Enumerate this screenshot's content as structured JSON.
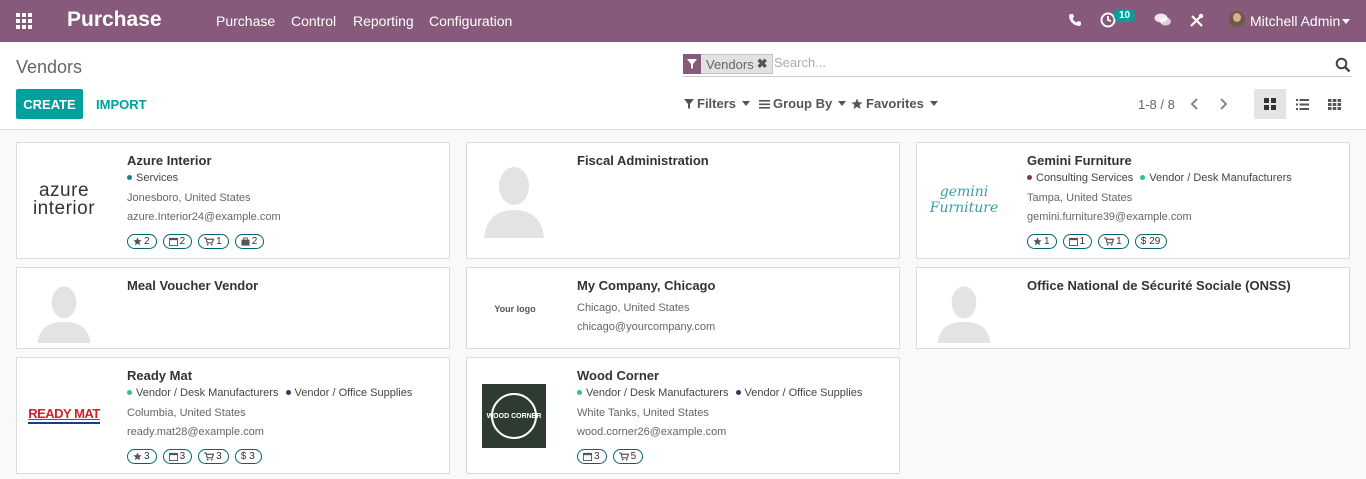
{
  "navbar": {
    "brand": "Purchase",
    "menu": [
      "Purchase",
      "Control",
      "Reporting",
      "Configuration"
    ],
    "activity_count": "10",
    "user_name": "Mitchell Admin"
  },
  "control_panel": {
    "breadcrumb": "Vendors",
    "facet": "Vendors",
    "search_placeholder": "Search...",
    "create_label": "CREATE",
    "import_label": "IMPORT",
    "filters_label": "Filters",
    "group_by_label": "Group By",
    "favorites_label": "Favorites",
    "pager": "1-8 / 8"
  },
  "colors": {
    "brand": "#875a7b",
    "accent": "#00a09d",
    "tag_services": "#1e7f87",
    "tag_consulting": "#7c3957",
    "tag_vendor_desk": "#30c381",
    "tag_vendor_office": "#2f3e5a"
  },
  "vendors": [
    {
      "name": "Azure Interior",
      "logo": "azure interior",
      "tags": [
        {
          "label": "Services",
          "color": "#1e7f87"
        }
      ],
      "location": "Jonesboro, United States",
      "email": "azure.Interior24@example.com",
      "stats": [
        {
          "icon": "star-icon",
          "value": "2"
        },
        {
          "icon": "calendar-icon",
          "value": "2"
        },
        {
          "icon": "cart-icon",
          "value": "1"
        },
        {
          "icon": "briefcase-icon",
          "value": "2"
        }
      ]
    },
    {
      "name": "Fiscal Administration",
      "logo": "",
      "tags": [],
      "location": "",
      "email": "",
      "stats": []
    },
    {
      "name": "Gemini Furniture",
      "logo": "gemini Furniture",
      "tags": [
        {
          "label": "Consulting Services",
          "color": "#7c3957"
        },
        {
          "label": "Vendor / Desk Manufacturers",
          "color": "#30c381"
        }
      ],
      "location": "Tampa, United States",
      "email": "gemini.furniture39@example.com",
      "stats": [
        {
          "icon": "star-icon",
          "value": "1"
        },
        {
          "icon": "calendar-icon",
          "value": "1"
        },
        {
          "icon": "cart-icon",
          "value": "1"
        },
        {
          "icon": "dollar-icon",
          "value": "29"
        }
      ]
    },
    {
      "name": "Meal Voucher Vendor",
      "logo": "",
      "tags": [],
      "location": "",
      "email": "",
      "stats": []
    },
    {
      "name": "My Company, Chicago",
      "logo": "Your logo",
      "tags": [],
      "location": "Chicago, United States",
      "email": "chicago@yourcompany.com",
      "stats": []
    },
    {
      "name": "Office National de Sécurité Sociale (ONSS)",
      "logo": "",
      "tags": [],
      "location": "",
      "email": "",
      "stats": []
    },
    {
      "name": "Ready Mat",
      "logo": "READY MAT",
      "tags": [
        {
          "label": "Vendor / Desk Manufacturers",
          "color": "#30c381"
        },
        {
          "label": "Vendor / Office Supplies",
          "color": "#2f3e5a"
        }
      ],
      "location": "Columbia, United States",
      "email": "ready.mat28@example.com",
      "stats": [
        {
          "icon": "star-icon",
          "value": "3"
        },
        {
          "icon": "calendar-icon",
          "value": "3"
        },
        {
          "icon": "cart-icon",
          "value": "3"
        },
        {
          "icon": "dollar-icon",
          "value": "3"
        }
      ]
    },
    {
      "name": "Wood Corner",
      "logo": "WOOD CORNER",
      "tags": [
        {
          "label": "Vendor / Desk Manufacturers",
          "color": "#30c381"
        },
        {
          "label": "Vendor / Office Supplies",
          "color": "#2f3e5a"
        }
      ],
      "location": "White Tanks, United States",
      "email": "wood.corner26@example.com",
      "stats": [
        {
          "icon": "calendar-icon",
          "value": "3"
        },
        {
          "icon": "cart-icon",
          "value": "5"
        }
      ]
    }
  ]
}
